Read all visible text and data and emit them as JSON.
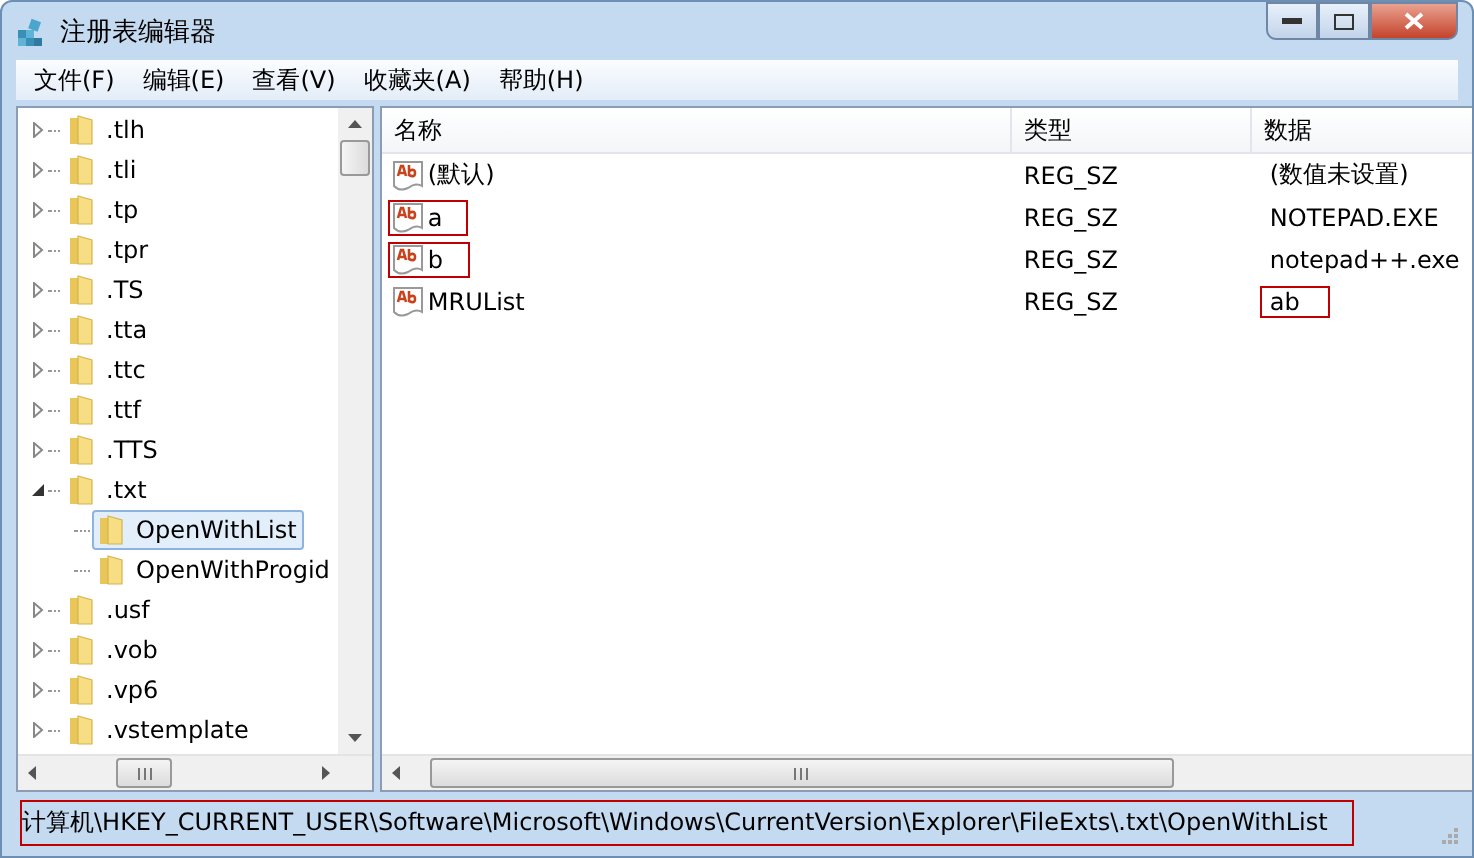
{
  "window": {
    "title": "注册表编辑器"
  },
  "menu": [
    {
      "label": "文件(F)"
    },
    {
      "label": "编辑(E)"
    },
    {
      "label": "查看(V)"
    },
    {
      "label": "收藏夹(A)"
    },
    {
      "label": "帮助(H)"
    }
  ],
  "tree": [
    {
      "label": ".tlh",
      "expanded": false,
      "selected": false
    },
    {
      "label": ".tli",
      "expanded": false,
      "selected": false
    },
    {
      "label": ".tp",
      "expanded": false,
      "selected": false
    },
    {
      "label": ".tpr",
      "expanded": false,
      "selected": false
    },
    {
      "label": ".TS",
      "expanded": false,
      "selected": false
    },
    {
      "label": ".tta",
      "expanded": false,
      "selected": false
    },
    {
      "label": ".ttc",
      "expanded": false,
      "selected": false
    },
    {
      "label": ".ttf",
      "expanded": false,
      "selected": false
    },
    {
      "label": ".TTS",
      "expanded": false,
      "selected": false
    },
    {
      "label": ".txt",
      "expanded": true,
      "selected": false,
      "children": [
        {
          "label": "OpenWithList",
          "selected": true
        },
        {
          "label": "OpenWithProgid",
          "selected": false
        }
      ]
    },
    {
      "label": ".usf",
      "expanded": false,
      "selected": false
    },
    {
      "label": ".vob",
      "expanded": false,
      "selected": false
    },
    {
      "label": ".vp6",
      "expanded": false,
      "selected": false
    },
    {
      "label": ".vstemplate",
      "expanded": false,
      "selected": false
    }
  ],
  "table": {
    "columns": [
      "名称",
      "类型",
      "数据"
    ],
    "rows": [
      {
        "name": "(默认)",
        "type": "REG_SZ",
        "data": "(数值未设置)",
        "name_marked": false,
        "data_marked": false
      },
      {
        "name": "a",
        "type": "REG_SZ",
        "data": "NOTEPAD.EXE",
        "name_marked": true,
        "data_marked": false
      },
      {
        "name": "b",
        "type": "REG_SZ",
        "data": "notepad++.exe",
        "name_marked": true,
        "data_marked": false
      },
      {
        "name": "MRUList",
        "type": "REG_SZ",
        "data": "ab",
        "name_marked": false,
        "data_marked": true
      }
    ]
  },
  "status_bar": {
    "text": "计算机\\HKEY_CURRENT_USER\\Software\\Microsoft\\Windows\\CurrentVersion\\Explorer\\FileExts\\.txt\\OpenWithList",
    "marked": true
  }
}
